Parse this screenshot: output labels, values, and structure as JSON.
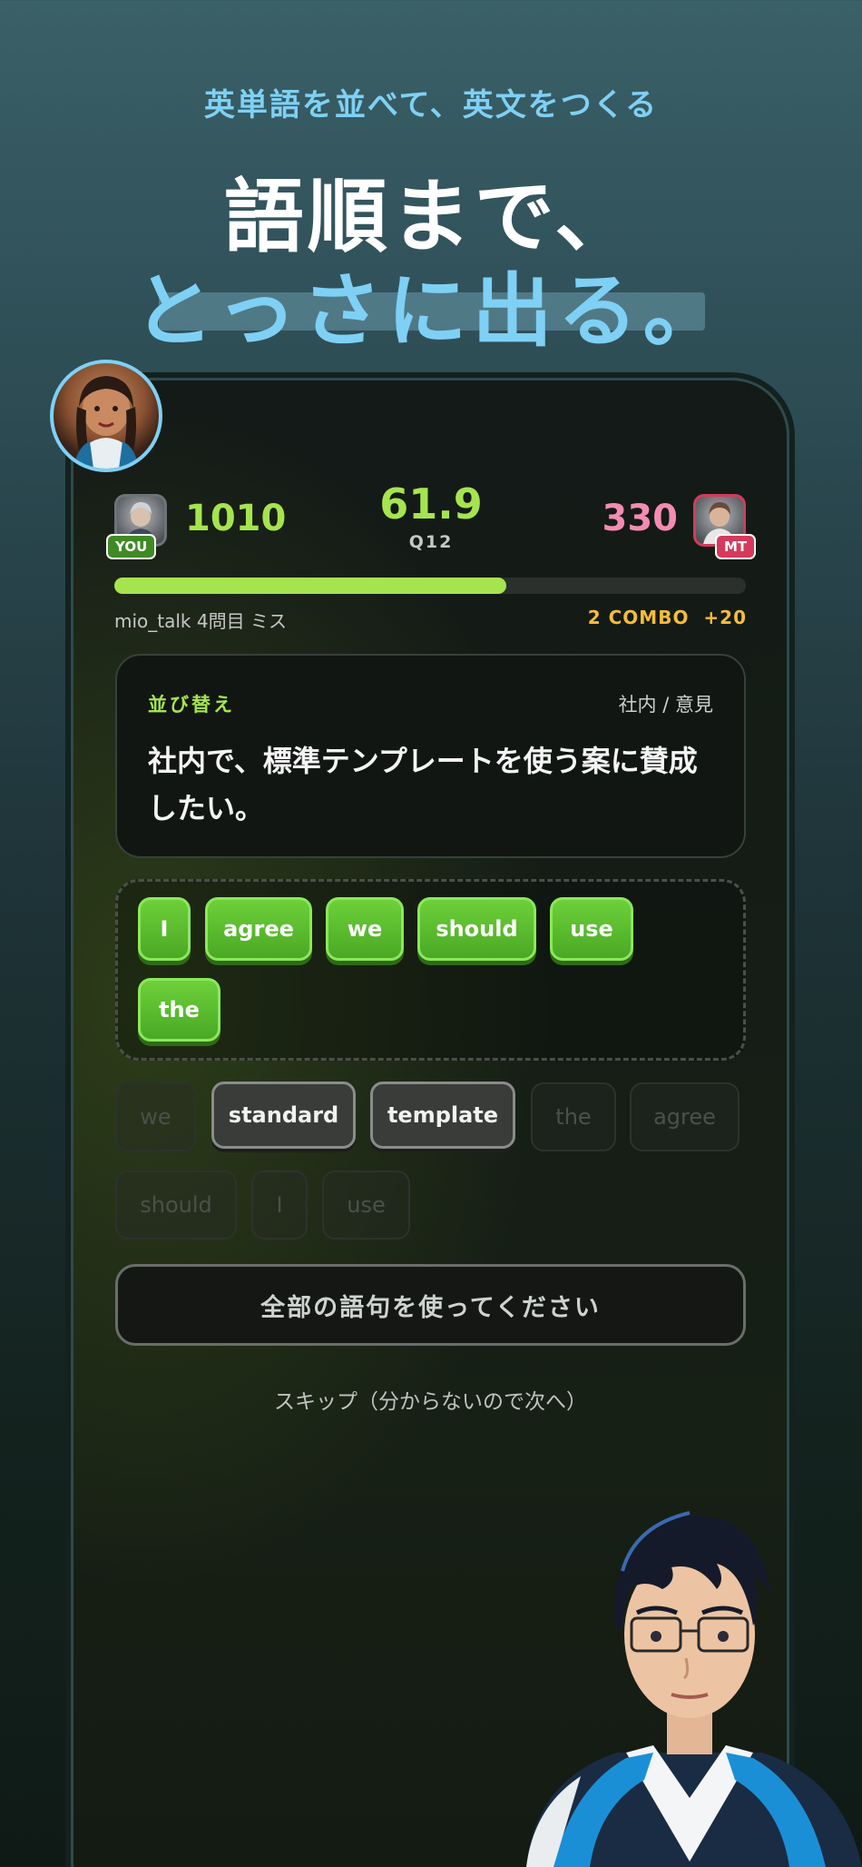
{
  "header": {
    "tagline": "英単語を並べて、英文をつくる",
    "headline_line1": "語順まで、",
    "headline_line2": "とっさに出る。"
  },
  "scoreboard": {
    "you_tag": "YOU",
    "you_score": "1010",
    "timer": "61.9",
    "question_number": "Q12",
    "opponent_score": "330",
    "opponent_tag": "MT",
    "progress_fraction": 0.62
  },
  "status": {
    "feed": "mio_talk 4問目 ミス",
    "combo": "2 COMBO",
    "bonus": "+20"
  },
  "question": {
    "type": "並び替え",
    "category": "社内 / 意見",
    "text": "社内で、標準テンプレートを使う案に賛成したい。"
  },
  "answer_chips": [
    "I",
    "agree",
    "we",
    "should",
    "use",
    "the"
  ],
  "word_bank": {
    "row1": [
      "we",
      "standard",
      "template",
      "the",
      "agree"
    ],
    "row2": [
      "should",
      "I",
      "use"
    ],
    "available": [
      "standard",
      "template"
    ]
  },
  "actions": {
    "submit_label": "全部の語句を使ってください",
    "skip_label": "スキップ（分からないので次へ）"
  },
  "colors": {
    "accent_green": "#a6e44f",
    "accent_blue": "#7fd0f5",
    "opponent_pink": "#f48bb2",
    "combo_gold": "#f5bc3c"
  }
}
